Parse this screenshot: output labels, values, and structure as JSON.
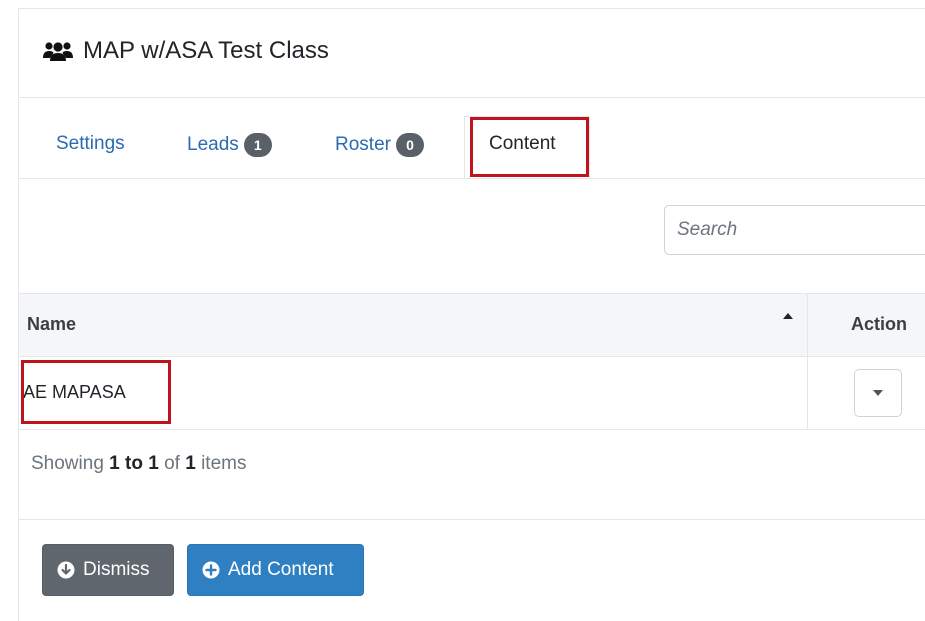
{
  "header": {
    "title": "MAP w/ASA Test Class",
    "icon": "users-icon"
  },
  "tabs": [
    {
      "label": "Settings",
      "badge": null
    },
    {
      "label": "Leads",
      "badge": "1"
    },
    {
      "label": "Roster",
      "badge": "0"
    },
    {
      "label": "Content",
      "active": true
    }
  ],
  "search": {
    "placeholder": "Search",
    "value": ""
  },
  "table": {
    "columns": [
      "Name",
      "Action"
    ],
    "rows": [
      {
        "name": "AE MAPASA"
      }
    ]
  },
  "pagination": {
    "prefix": "Showing",
    "range": "1 to 1",
    "of": "of",
    "total": "1",
    "suffix": "items"
  },
  "buttons": {
    "dismiss": "Dismiss",
    "add_content": "Add Content"
  },
  "colors": {
    "link": "#2b6cb0",
    "badge": "#5a6068",
    "highlight": "#c0141c",
    "dismiss": "#5f666d",
    "primary": "#2f80c3"
  }
}
